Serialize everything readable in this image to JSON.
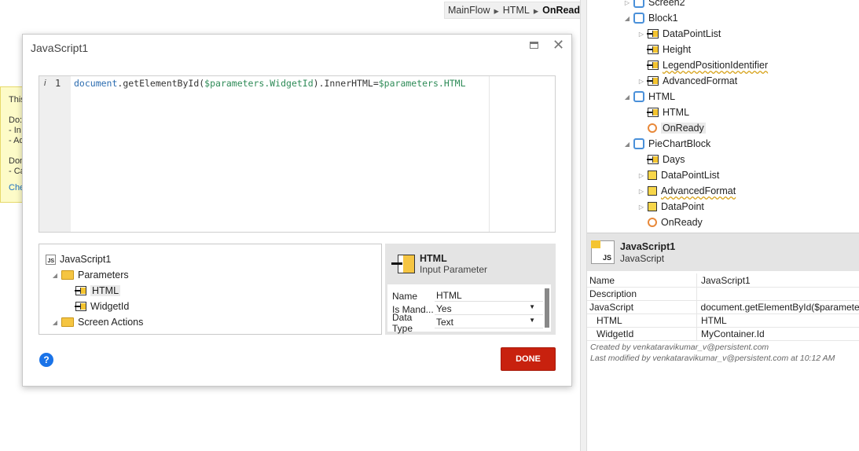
{
  "breadcrumb": {
    "items": [
      "MainFlow",
      "HTML"
    ],
    "current": "OnReady",
    "separator": "▸"
  },
  "note": {
    "lines": [
      "This",
      "",
      "Do:",
      "- In",
      "- Ad",
      "",
      "Don",
      "- Ca"
    ],
    "link": "Che"
  },
  "tree": {
    "nodes": [
      {
        "label": "Screen2",
        "icon": "screen-icon"
      },
      {
        "label": "Block1",
        "icon": "block-icon"
      },
      {
        "label": "DataPointList",
        "icon": "input-parameter-icon"
      },
      {
        "label": "Height",
        "icon": "input-parameter-icon"
      },
      {
        "label": "LegendPositionIdentifier",
        "icon": "input-parameter-icon"
      },
      {
        "label": "AdvancedFormat",
        "icon": "input-parameter-icon"
      },
      {
        "label": "HTML",
        "icon": "block-icon"
      },
      {
        "label": "HTML",
        "icon": "input-parameter-icon"
      },
      {
        "label": "OnReady",
        "icon": "event-icon"
      },
      {
        "label": "PieChartBlock",
        "icon": "block-icon"
      },
      {
        "label": "Days",
        "icon": "input-parameter-icon"
      },
      {
        "label": "DataPointList",
        "icon": "structure-icon"
      },
      {
        "label": "AdvancedFormat",
        "icon": "structure-icon"
      },
      {
        "label": "DataPoint",
        "icon": "structure-icon"
      },
      {
        "label": "OnReady",
        "icon": "event-icon"
      }
    ]
  },
  "props": {
    "title": "JavaScript1",
    "subtitle": "JavaScript",
    "icon_text": "JS",
    "rows": [
      {
        "key": "Name",
        "value": "JavaScript1"
      },
      {
        "key": "Description",
        "value": ""
      },
      {
        "key": "JavaScript",
        "value": "document.getElementById($paramete"
      },
      {
        "key": "HTML",
        "value": "HTML"
      },
      {
        "key": "WidgetId",
        "value": "MyContainer.Id"
      }
    ],
    "created_by": "Created by venkataravikumar_v@persistent.com",
    "modified_by": "Last modified by venkataravikumar_v@persistent.com at 10:12 AM"
  },
  "dialog": {
    "title": "JavaScript1",
    "editor": {
      "gutter_marker": "i",
      "line_number": "1",
      "code_parts": [
        "document",
        ".getElementById(",
        "$parameters.WidgetId",
        ").InnerHTML=",
        "$parameters.HTML"
      ]
    },
    "object_tree": {
      "root": "JavaScript1",
      "root_icon_text": "JS",
      "parameters": "Parameters",
      "param_items": [
        "HTML",
        "WidgetId"
      ],
      "screen_actions": "Screen Actions"
    },
    "param_detail": {
      "title": "HTML",
      "subtitle": "Input Parameter",
      "rows": [
        {
          "key": "Name",
          "value": "HTML",
          "dropdown": false
        },
        {
          "key": "Is Mand...",
          "value": "Yes",
          "dropdown": true
        },
        {
          "key": "Data Type",
          "value": "Text",
          "dropdown": true
        }
      ]
    },
    "help_label": "?",
    "done_label": "DONE"
  },
  "colors": {
    "done_button": "#c8210e",
    "help_button": "#1a73e8",
    "note_bg": "#fdfbc8"
  }
}
